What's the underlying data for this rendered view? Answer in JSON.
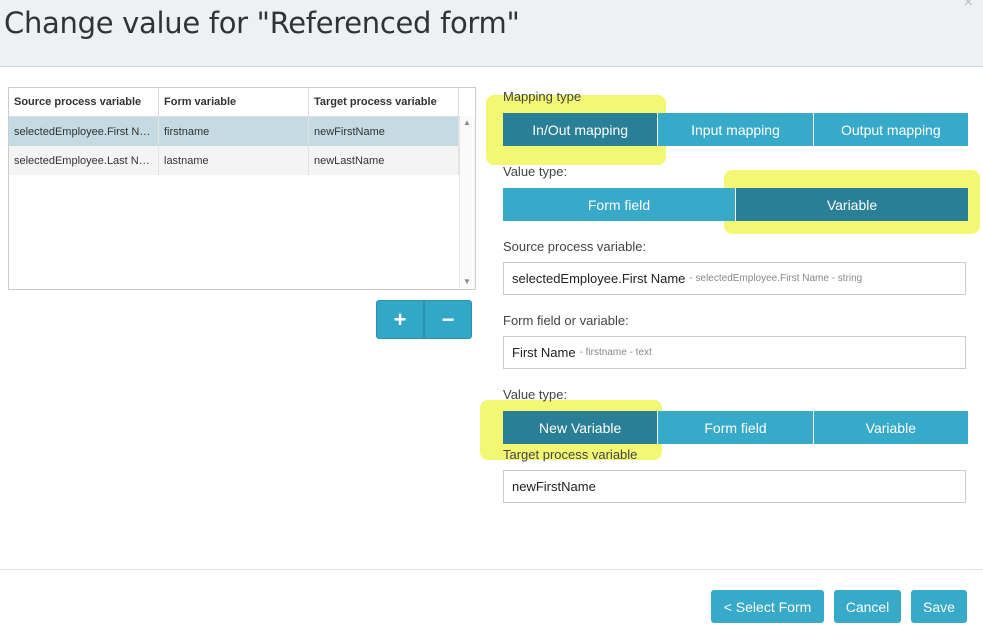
{
  "dialog": {
    "title": "Change value for \"Referenced form\"",
    "close": "×"
  },
  "table": {
    "columns": [
      "Source process variable",
      "Form variable",
      "Target process variable"
    ],
    "rows": [
      [
        "selectedEmployee.First Name",
        "firstname",
        "newFirstName"
      ],
      [
        "selectedEmployee.Last Name",
        "lastname",
        "newLastName"
      ]
    ],
    "scroll_up": "▲",
    "scroll_down": "▼"
  },
  "row_buttons": {
    "add": "+",
    "remove": "−"
  },
  "mapping": {
    "label": "Mapping type",
    "options": [
      "In/Out mapping",
      "Input mapping",
      "Output mapping"
    ],
    "selected": "In/Out mapping"
  },
  "value_type_source": {
    "label": "Value type:",
    "options": [
      "Form field",
      "Variable"
    ],
    "selected": "Variable"
  },
  "source_variable": {
    "label": "Source process variable:",
    "value": "selectedEmployee.First Name",
    "detail": "- selectedEmployee.First Name - string"
  },
  "form_field": {
    "label": "Form field or variable:",
    "value": "First Name",
    "detail": "- firstname - text"
  },
  "value_type_target": {
    "label": "Value type:",
    "options": [
      "New Variable",
      "Form field",
      "Variable"
    ],
    "selected": "New Variable"
  },
  "target_variable": {
    "label": "Target process variable",
    "value": "newFirstName"
  },
  "footer": {
    "select_form": "< Select Form",
    "cancel": "Cancel",
    "save": "Save"
  },
  "colors": {
    "accent": "#37a9c9",
    "accent_active": "#287f96",
    "highlight": "#e8f200"
  }
}
